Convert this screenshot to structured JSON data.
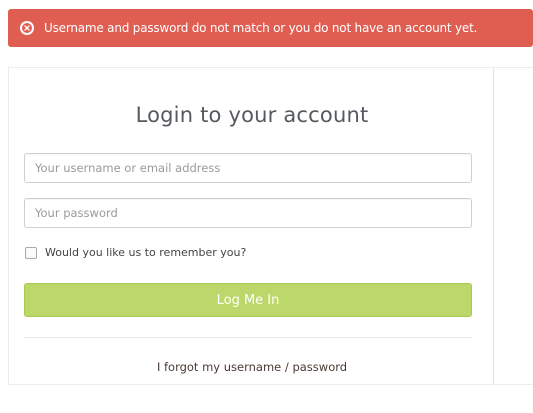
{
  "alert": {
    "message": "Username and password do not match or you do not have an account yet.",
    "icon": "error-icon",
    "color": "#df5e51"
  },
  "login": {
    "title": "Login to your account",
    "username_placeholder": "Your username or email address",
    "username_value": "",
    "password_placeholder": "Your password",
    "password_value": "",
    "remember_label": "Would you like us to remember you?",
    "remember_checked": false,
    "submit_label": "Log Me In",
    "submit_color": "#bdd86a",
    "forgot_text_prefix": "I forgot my ",
    "forgot_username_label": "username",
    "forgot_separator": " / ",
    "forgot_password_label": "password"
  }
}
